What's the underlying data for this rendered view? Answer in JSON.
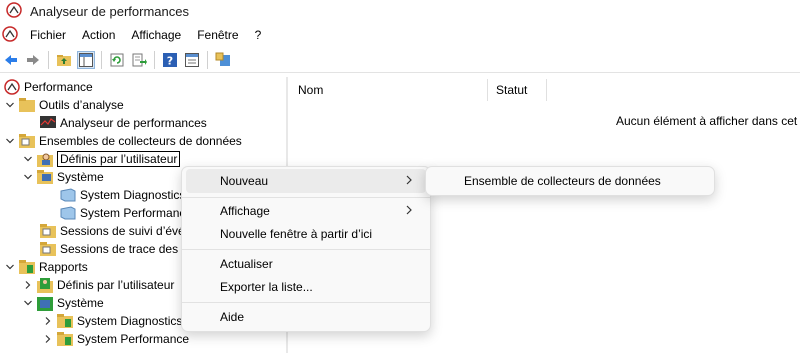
{
  "window": {
    "title": "Analyseur de performances"
  },
  "menubar": {
    "items": [
      "Fichier",
      "Action",
      "Affichage",
      "Fenêtre",
      "?"
    ]
  },
  "toolbar": {
    "buttons": [
      "back-arrow-icon",
      "forward-arrow-icon",
      "up-folder-icon",
      "show-hide-tree-icon",
      "refresh-icon",
      "export-list-icon",
      "help-icon",
      "properties-icon",
      "new-window-icon"
    ]
  },
  "tree": {
    "root": "Performance",
    "outils": "Outils d’analyse",
    "analyseur": "Analyseur de performances",
    "ensembles": "Ensembles de collecteurs de données",
    "definis": "Définis par l’utilisateur",
    "systeme": "Système",
    "sysdiag": "System Diagnostics",
    "sysperf": "System Performance",
    "sessions_suivi": "Sessions de suivi d’évé",
    "sessions_trace": "Sessions de trace des é",
    "rapports": "Rapports",
    "r_definis": "Définis par l’utilisateur",
    "r_systeme": "Système",
    "r_sysdiag": "System Diagnostics",
    "r_sysperf": "System Performance"
  },
  "list": {
    "columns": [
      "Nom",
      "Statut"
    ],
    "empty_text": "Aucun élément à afficher dans cet"
  },
  "context_menu": {
    "nouveau": "Nouveau",
    "affichage": "Affichage",
    "nouvelle_fenetre": "Nouvelle fenêtre à partir d’ici",
    "actualiser": "Actualiser",
    "exporter": "Exporter la liste...",
    "aide": "Aide"
  },
  "submenu": {
    "ensemble": "Ensemble de collecteurs de données"
  }
}
